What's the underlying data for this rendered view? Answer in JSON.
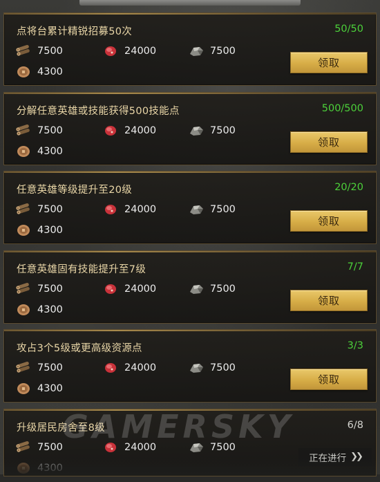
{
  "tasks": [
    {
      "title": "点将台累计精锐招募50次",
      "progress": "50/50",
      "wood": "7500",
      "food": "24000",
      "iron": "7500",
      "coin": "4300",
      "action": "领取"
    },
    {
      "title": "分解任意英雄或技能获得500技能点",
      "progress": "500/500",
      "wood": "7500",
      "food": "24000",
      "iron": "7500",
      "coin": "4300",
      "action": "领取"
    },
    {
      "title": "任意英雄等级提升至20级",
      "progress": "20/20",
      "wood": "7500",
      "food": "24000",
      "iron": "7500",
      "coin": "4300",
      "action": "领取"
    },
    {
      "title": "任意英雄固有技能提升至7级",
      "progress": "7/7",
      "wood": "7500",
      "food": "24000",
      "iron": "7500",
      "coin": "4300",
      "action": "领取"
    },
    {
      "title": "攻占3个5级或更高级资源点",
      "progress": "3/3",
      "wood": "7500",
      "food": "24000",
      "iron": "7500",
      "coin": "4300",
      "action": "领取"
    },
    {
      "title": "升级居民房舍至8级",
      "progress": "6/8",
      "wood": "7500",
      "food": "24000",
      "iron": "7500",
      "coin": "4300",
      "status": "正在进行"
    }
  ],
  "icons": {
    "wood": "wood-logs-icon",
    "food": "meat-icon",
    "iron": "iron-ore-icon",
    "coin": "copper-coin-icon",
    "chevron": "double-chevron-right-icon"
  },
  "colors": {
    "complete": "#4cd13a",
    "button": "#d7ad47",
    "title": "#e9d6a7"
  },
  "watermark": "GAMERSKY"
}
